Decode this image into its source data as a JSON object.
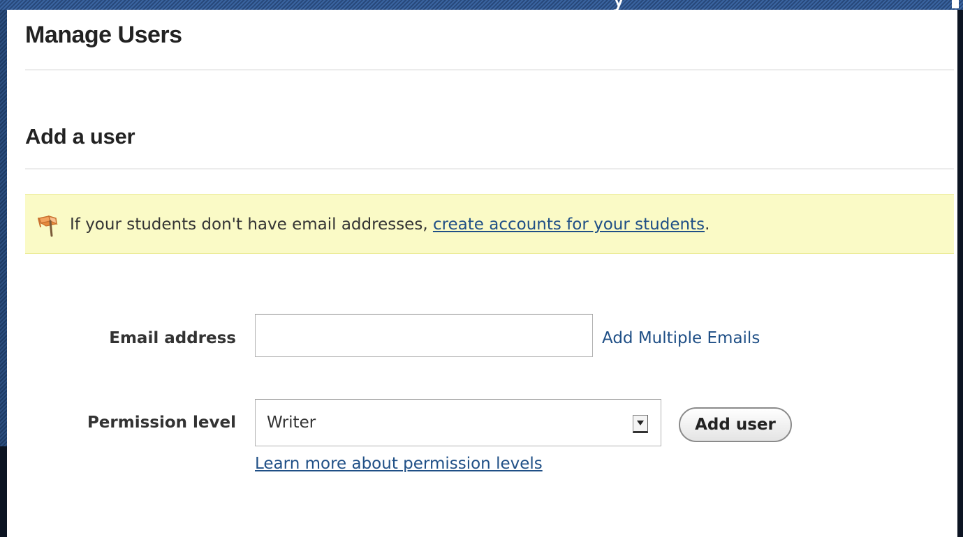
{
  "page": {
    "title": "Manage Users"
  },
  "add_user_section": {
    "title": "Add a user"
  },
  "notice": {
    "icon": "flag-icon",
    "text_before": "If your students don't have email addresses, ",
    "link_text": "create accounts for your students",
    "text_after": "."
  },
  "form": {
    "email_label": "Email address",
    "email_value": "",
    "add_multiple_link": "Add Multiple Emails",
    "permission_label": "Permission level",
    "permission_selected": "Writer",
    "add_user_button": "Add user",
    "learn_more_link": "Learn more about permission levels"
  },
  "colors": {
    "link": "#1f4f86",
    "notice_background": "#fafac6",
    "slide_background": "#1d3250"
  }
}
